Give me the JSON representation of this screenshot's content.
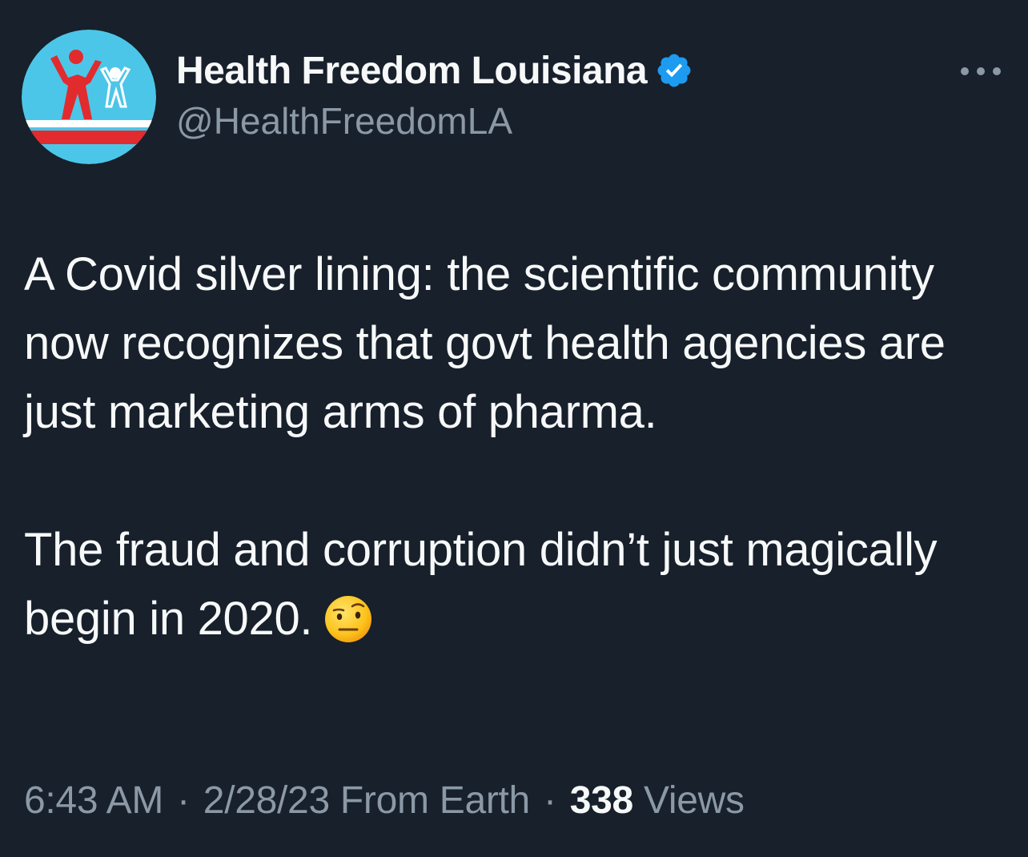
{
  "colors": {
    "background": "#17202b",
    "primary_text": "#f7f9f9",
    "secondary_text": "#8b98a5",
    "verified_blue": "#1d9bf0",
    "avatar_bg": "#4cc6e8",
    "avatar_red": "#e12b2f"
  },
  "author": {
    "display_name": "Health Freedom Louisiana",
    "handle": "@HealthFreedomLA",
    "avatar_icon": "health-freedom-logo",
    "verified_icon": "verified-badge-icon"
  },
  "more_icon": "more-options-icon",
  "tweet": {
    "paragraphs": [
      "A Covid silver lining: the scientific community now recognizes that govt health agencies are just marketing arms of pharma.",
      "The fraud and corruption didn’t just magically begin in 2020."
    ],
    "emoji": "face-with-raised-eyebrow"
  },
  "meta": {
    "time": "6:43 AM",
    "sep1": "·",
    "date": "2/28/23",
    "source": "From Earth",
    "sep2": "·",
    "views_count": "338",
    "views_label": "Views"
  }
}
